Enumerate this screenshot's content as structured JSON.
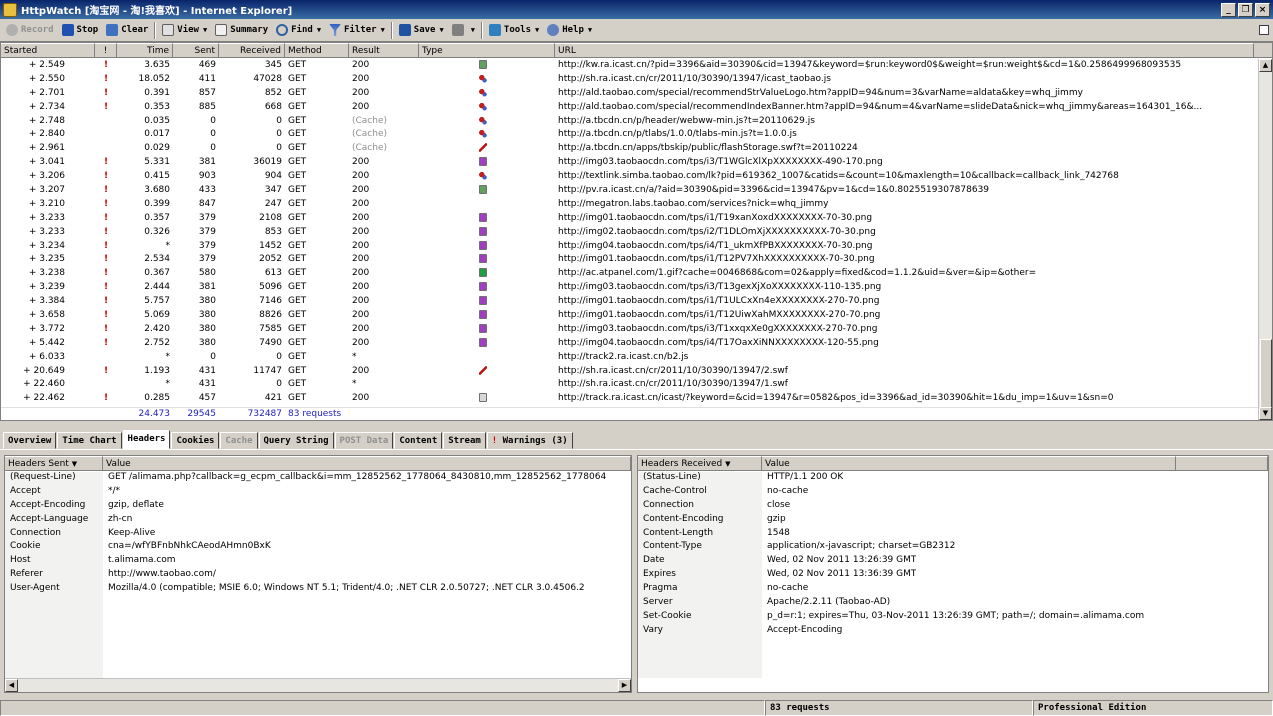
{
  "window": {
    "title": "HttpWatch [淘宝网 - 淘!我喜欢] - Internet Explorer]"
  },
  "toolbar": {
    "record": "Record",
    "stop": "Stop",
    "clear": "Clear",
    "view": "View",
    "summary": "Summary",
    "find": "Find",
    "filter": "Filter",
    "save": "Save",
    "tools": "Tools",
    "help": "Help"
  },
  "grid": {
    "columns": {
      "started": "Started",
      "flag": "!",
      "time": "Time",
      "sent": "Sent",
      "received": "Received",
      "method": "Method",
      "result": "Result",
      "type": "Type",
      "url": "URL"
    },
    "rows": [
      {
        "started": "+ 2.549",
        "flag": "!",
        "time": "3.635",
        "sent": "469",
        "received": "345",
        "method": "GET",
        "result": "200",
        "type_icon": "script-doc-icon",
        "url": "http://kw.ra.icast.cn/?pid=3396&aid=30390&cid=13947&keyword=$run:keyword0$&weight=$run:weight$&cd=1&0.2586499968093535"
      },
      {
        "started": "+ 2.550",
        "flag": "!",
        "time": "18.052",
        "sent": "411",
        "received": "47028",
        "method": "GET",
        "result": "200",
        "type_icon": "js-icon",
        "url": "http://sh.ra.icast.cn/cr/2011/10/30390/13947/icast_taobao.js"
      },
      {
        "started": "+ 2.701",
        "flag": "!",
        "time": "0.391",
        "sent": "857",
        "received": "852",
        "method": "GET",
        "result": "200",
        "type_icon": "js-icon",
        "url": "http://ald.taobao.com/special/recommendStrValueLogo.htm?appID=94&num=3&varName=aldata&key=whq_jimmy"
      },
      {
        "started": "+ 2.734",
        "flag": "!",
        "time": "0.353",
        "sent": "885",
        "received": "668",
        "method": "GET",
        "result": "200",
        "type_icon": "js-icon",
        "url": "http://ald.taobao.com/special/recommendIndexBanner.htm?appID=94&num=4&varName=slideData&nick=whq_jimmy&areas=164301_16&..."
      },
      {
        "started": "+ 2.748",
        "flag": "",
        "time": "0.035",
        "sent": "0",
        "received": "0",
        "method": "GET",
        "result": "(Cache)",
        "type_icon": "js-icon",
        "url": "http://a.tbcdn.cn/p/header/webww-min.js?t=20110629.js"
      },
      {
        "started": "+ 2.840",
        "flag": "",
        "time": "0.017",
        "sent": "0",
        "received": "0",
        "method": "GET",
        "result": "(Cache)",
        "type_icon": "js-icon",
        "url": "http://a.tbcdn.cn/p/tlabs/1.0.0/tlabs-min.js?t=1.0.0.js"
      },
      {
        "started": "+ 2.961",
        "flag": "",
        "time": "0.029",
        "sent": "0",
        "received": "0",
        "method": "GET",
        "result": "(Cache)",
        "type_icon": "flash-icon",
        "url": "http://a.tbcdn.cn/apps/tbskip/public/flashStorage.swf?t=20110224"
      },
      {
        "started": "+ 3.041",
        "flag": "!",
        "time": "5.331",
        "sent": "381",
        "received": "36019",
        "method": "GET",
        "result": "200",
        "type_icon": "image-icon",
        "url": "http://img03.taobaocdn.com/tps/i3/T1WGlcXlXpXXXXXXXX-490-170.png"
      },
      {
        "started": "+ 3.206",
        "flag": "!",
        "time": "0.415",
        "sent": "903",
        "received": "904",
        "method": "GET",
        "result": "200",
        "type_icon": "js-icon",
        "url": "http://textlink.simba.taobao.com/lk?pid=619362_1007&catids=&count=10&maxlength=10&callback=callback_link_742768"
      },
      {
        "started": "+ 3.207",
        "flag": "!",
        "time": "3.680",
        "sent": "433",
        "received": "347",
        "method": "GET",
        "result": "200",
        "type_icon": "script-doc-icon",
        "url": "http://pv.ra.icast.cn/a/?aid=30390&pid=3396&cid=13947&pv=1&cd=1&0.8025519307878639"
      },
      {
        "started": "+ 3.210",
        "flag": "!",
        "time": "0.399",
        "sent": "847",
        "received": "247",
        "method": "GET",
        "result": "200",
        "type_icon": "",
        "url": "http://megatron.labs.taobao.com/services?nick=whq_jimmy"
      },
      {
        "started": "+ 3.233",
        "flag": "!",
        "time": "0.357",
        "sent": "379",
        "received": "2108",
        "method": "GET",
        "result": "200",
        "type_icon": "image-icon",
        "url": "http://img01.taobaocdn.com/tps/i1/T19xanXoxdXXXXXXXX-70-30.png"
      },
      {
        "started": "+ 3.233",
        "flag": "!",
        "time": "0.326",
        "sent": "379",
        "received": "853",
        "method": "GET",
        "result": "200",
        "type_icon": "image-icon",
        "url": "http://img02.taobaocdn.com/tps/i2/T1DLOmXjXXXXXXXXXX-70-30.png"
      },
      {
        "started": "+ 3.234",
        "flag": "!",
        "time": "*",
        "sent": "379",
        "received": "1452",
        "method": "GET",
        "result": "200",
        "type_icon": "image-icon",
        "url": "http://img04.taobaocdn.com/tps/i4/T1_ukmXfPBXXXXXXXX-70-30.png"
      },
      {
        "started": "+ 3.235",
        "flag": "!",
        "time": "2.534",
        "sent": "379",
        "received": "2052",
        "method": "GET",
        "result": "200",
        "type_icon": "image-icon",
        "url": "http://img01.taobaocdn.com/tps/i1/T12PV7XhXXXXXXXXXX-70-30.png"
      },
      {
        "started": "+ 3.238",
        "flag": "!",
        "time": "0.367",
        "sent": "580",
        "received": "613",
        "method": "GET",
        "result": "200",
        "type_icon": "gif-icon",
        "url": "http://ac.atpanel.com/1.gif?cache=0046868&com=02&apply=fixed&cod=1.1.2&uid=&ver=&ip=&other="
      },
      {
        "started": "+ 3.239",
        "flag": "!",
        "time": "2.444",
        "sent": "381",
        "received": "5096",
        "method": "GET",
        "result": "200",
        "type_icon": "image-icon",
        "url": "http://img03.taobaocdn.com/tps/i3/T13gexXjXoXXXXXXXX-110-135.png"
      },
      {
        "started": "+ 3.384",
        "flag": "!",
        "time": "5.757",
        "sent": "380",
        "received": "7146",
        "method": "GET",
        "result": "200",
        "type_icon": "image-icon",
        "url": "http://img01.taobaocdn.com/tps/i1/T1ULCxXn4eXXXXXXXX-270-70.png"
      },
      {
        "started": "+ 3.658",
        "flag": "!",
        "time": "5.069",
        "sent": "380",
        "received": "8826",
        "method": "GET",
        "result": "200",
        "type_icon": "image-icon",
        "url": "http://img01.taobaocdn.com/tps/i1/T12UiwXahMXXXXXXXX-270-70.png"
      },
      {
        "started": "+ 3.772",
        "flag": "!",
        "time": "2.420",
        "sent": "380",
        "received": "7585",
        "method": "GET",
        "result": "200",
        "type_icon": "image-icon",
        "url": "http://img03.taobaocdn.com/tps/i3/T1xxqxXe0gXXXXXXXX-270-70.png"
      },
      {
        "started": "+ 5.442",
        "flag": "!",
        "time": "2.752",
        "sent": "380",
        "received": "7490",
        "method": "GET",
        "result": "200",
        "type_icon": "image-icon",
        "url": "http://img04.taobaocdn.com/tps/i4/T17OaxXiNNXXXXXXXX-120-55.png"
      },
      {
        "started": "+ 6.033",
        "flag": "",
        "time": "*",
        "sent": "0",
        "received": "0",
        "method": "GET",
        "result": "*",
        "type_icon": "",
        "url": "http://track2.ra.icast.cn/b2.js"
      },
      {
        "started": "+ 20.649",
        "flag": "!",
        "time": "1.193",
        "sent": "431",
        "received": "11747",
        "method": "GET",
        "result": "200",
        "type_icon": "flash-icon",
        "url": "http://sh.ra.icast.cn/cr/2011/10/30390/13947/2.swf"
      },
      {
        "started": "+ 22.460",
        "flag": "",
        "time": "*",
        "sent": "431",
        "received": "0",
        "method": "GET",
        "result": "*",
        "type_icon": "",
        "url": "http://sh.ra.icast.cn/cr/2011/10/30390/13947/1.swf"
      },
      {
        "started": "+ 22.462",
        "flag": "!",
        "time": "0.285",
        "sent": "457",
        "received": "421",
        "method": "GET",
        "result": "200",
        "type_icon": "blank-icon",
        "url": "http://track.ra.icast.cn/icast/?keyword=&cid=13947&r=0582&pos_id=3396&ad_id=30390&hit=1&du_imp=1&uv=1&sn=0"
      }
    ],
    "summary": {
      "time": "24.473",
      "sent": "29545",
      "received": "732487",
      "requests": "83 requests"
    }
  },
  "tabs": [
    {
      "label": "Overview",
      "state": "normal"
    },
    {
      "label": "Time Chart",
      "state": "normal"
    },
    {
      "label": "Headers",
      "state": "active"
    },
    {
      "label": "Cookies",
      "state": "normal"
    },
    {
      "label": "Cache",
      "state": "disabled"
    },
    {
      "label": "Query String",
      "state": "normal"
    },
    {
      "label": "POST Data",
      "state": "disabled"
    },
    {
      "label": "Content",
      "state": "normal"
    },
    {
      "label": "Stream",
      "state": "normal"
    },
    {
      "label": "Warnings (3)",
      "state": "warn",
      "mark": "!"
    }
  ],
  "headers_sent": {
    "col_name": "Headers Sent",
    "col_value": "Value",
    "rows": [
      {
        "name": "(Request-Line)",
        "value": "GET /alimama.php?callback=g_ecpm_callback&i=mm_12852562_1778064_8430810,mm_12852562_1778064"
      },
      {
        "name": "Accept",
        "value": "*/*"
      },
      {
        "name": "Accept-Encoding",
        "value": "gzip, deflate"
      },
      {
        "name": "Accept-Language",
        "value": "zh-cn"
      },
      {
        "name": "Connection",
        "value": "Keep-Alive"
      },
      {
        "name": "Cookie",
        "value": "cna=/wfYBFnbNhkCAeodAHmn0BxK"
      },
      {
        "name": "Host",
        "value": "t.alimama.com"
      },
      {
        "name": "Referer",
        "value": "http://www.taobao.com/"
      },
      {
        "name": "User-Agent",
        "value": "Mozilla/4.0 (compatible; MSIE 6.0; Windows NT 5.1; Trident/4.0; .NET CLR 2.0.50727; .NET CLR 3.0.4506.2"
      }
    ]
  },
  "headers_received": {
    "col_name": "Headers Received",
    "col_value": "Value",
    "rows": [
      {
        "name": "(Status-Line)",
        "value": "HTTP/1.1 200 OK"
      },
      {
        "name": "Cache-Control",
        "value": "no-cache"
      },
      {
        "name": "Connection",
        "value": "close"
      },
      {
        "name": "Content-Encoding",
        "value": "gzip"
      },
      {
        "name": "Content-Length",
        "value": "1548"
      },
      {
        "name": "Content-Type",
        "value": "application/x-javascript; charset=GB2312"
      },
      {
        "name": "Date",
        "value": "Wed, 02 Nov 2011 13:26:39 GMT"
      },
      {
        "name": "Expires",
        "value": "Wed, 02 Nov 2011 13:36:39 GMT"
      },
      {
        "name": "Pragma",
        "value": "no-cache"
      },
      {
        "name": "Server",
        "value": "Apache/2.2.11 (Taobao-AD)"
      },
      {
        "name": "Set-Cookie",
        "value": "p_d=r:1; expires=Thu, 03-Nov-2011 13:26:39 GMT; path=/; domain=.alimama.com"
      },
      {
        "name": "Vary",
        "value": "Accept-Encoding"
      }
    ]
  },
  "status": {
    "requests": "83 requests",
    "edition": "Professional Edition"
  },
  "colors": {
    "error_flag": "#d00000",
    "summary": "#2020c0",
    "cache": "#909090"
  }
}
